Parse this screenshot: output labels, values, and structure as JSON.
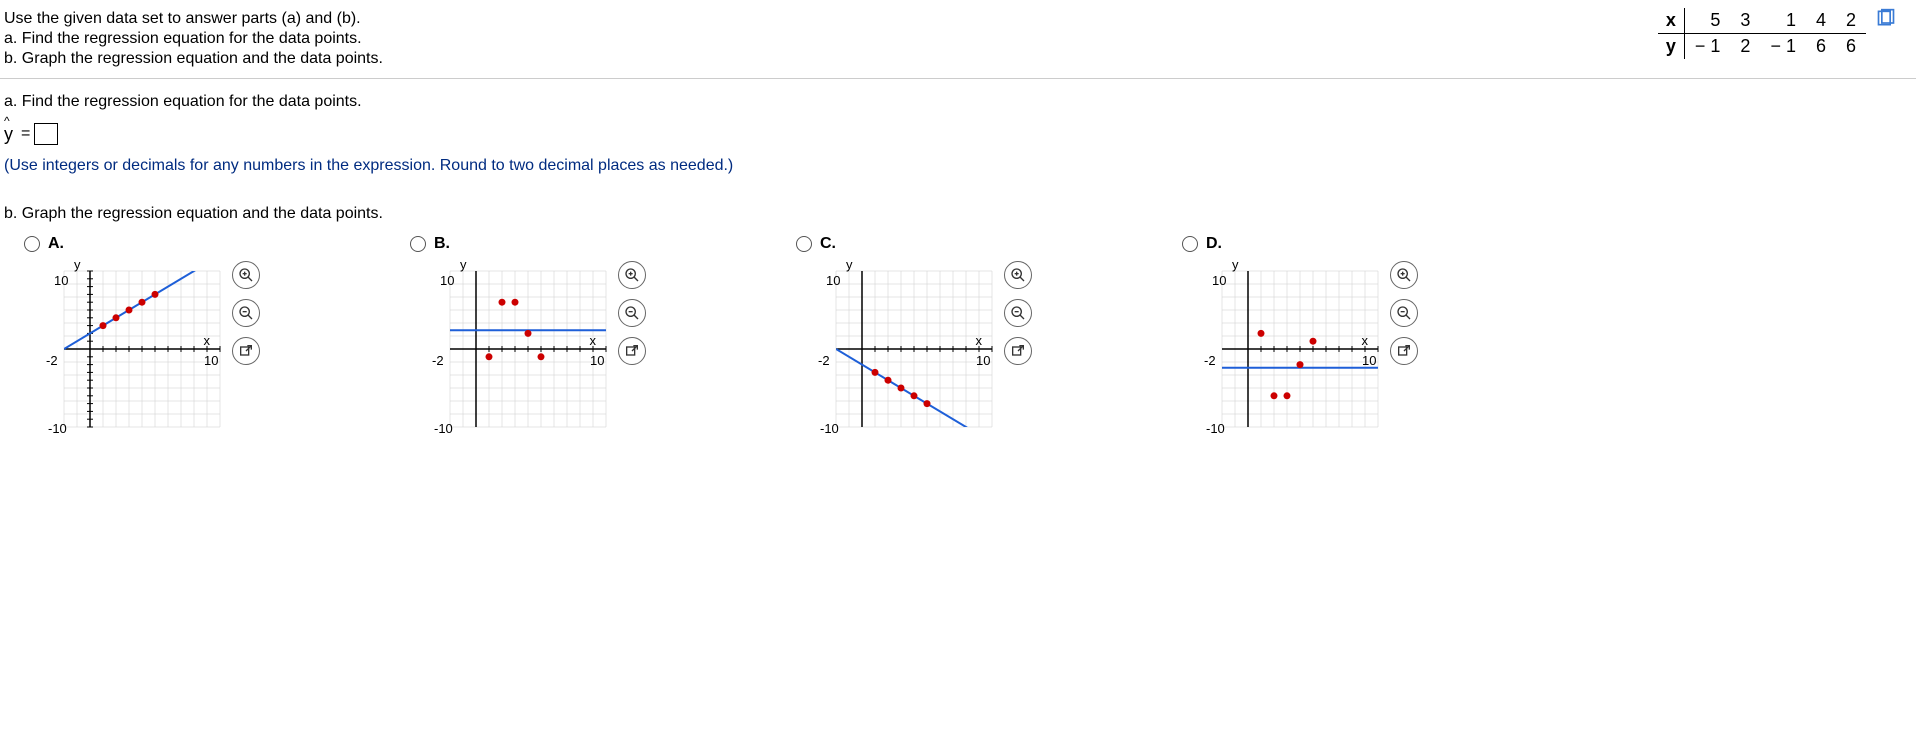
{
  "prompt": {
    "intro": "Use the given data set to answer parts (a) and (b).",
    "part_a": "a. Find the regression equation for the data points.",
    "part_b": "b. Graph the regression equation and the data points."
  },
  "data_table": {
    "x_label": "x",
    "y_label": "y",
    "x": [
      "5",
      "3",
      "1",
      "4",
      "2"
    ],
    "y": [
      "− 1",
      "2",
      "− 1",
      "6",
      "6"
    ]
  },
  "question_a": {
    "heading": "a. Find the regression equation for the data points.",
    "yhat": "y",
    "equals": " = ",
    "hint": "(Use integers or decimals for any numbers in the expression. Round to two decimal places as needed.)"
  },
  "question_b": {
    "heading": "b. Graph the regression equation and the data points."
  },
  "choices": {
    "a": {
      "label": "A."
    },
    "b": {
      "label": "B."
    },
    "c": {
      "label": "C."
    },
    "d": {
      "label": "D."
    }
  },
  "graph_labels": {
    "x": "x",
    "y": "y",
    "xmax": "10",
    "xmin": "-2",
    "ymax": "10",
    "ymin": "-10"
  },
  "chart_data": [
    {
      "type": "scatter",
      "choice": "A",
      "xlim": [
        -2,
        10
      ],
      "ylim": [
        -10,
        10
      ],
      "points": [
        [
          1,
          3
        ],
        [
          2,
          4
        ],
        [
          3,
          5
        ],
        [
          4,
          6
        ],
        [
          5,
          7
        ]
      ],
      "line": {
        "type": "sloped",
        "p1": [
          -2,
          0
        ],
        "p2": [
          10,
          12
        ]
      }
    },
    {
      "type": "scatter",
      "choice": "B",
      "xlim": [
        -2,
        10
      ],
      "ylim": [
        -10,
        10
      ],
      "points": [
        [
          1,
          -1
        ],
        [
          2,
          6
        ],
        [
          3,
          6
        ],
        [
          4,
          2
        ],
        [
          5,
          -1
        ]
      ],
      "line": {
        "type": "horizontal",
        "y": 2.4
      }
    },
    {
      "type": "scatter",
      "choice": "C",
      "xlim": [
        -2,
        10
      ],
      "ylim": [
        -10,
        10
      ],
      "points": [
        [
          1,
          -3
        ],
        [
          2,
          -4
        ],
        [
          3,
          -5
        ],
        [
          4,
          -6
        ],
        [
          5,
          -7
        ]
      ],
      "line": {
        "type": "sloped",
        "p1": [
          -2,
          0
        ],
        "p2": [
          10,
          -12
        ]
      }
    },
    {
      "type": "scatter",
      "choice": "D",
      "xlim": [
        -2,
        10
      ],
      "ylim": [
        -10,
        10
      ],
      "points": [
        [
          1,
          2
        ],
        [
          2,
          -6
        ],
        [
          3,
          -6
        ],
        [
          4,
          -2
        ],
        [
          5,
          1
        ]
      ],
      "line": {
        "type": "horizontal",
        "y": -2.4
      }
    }
  ]
}
